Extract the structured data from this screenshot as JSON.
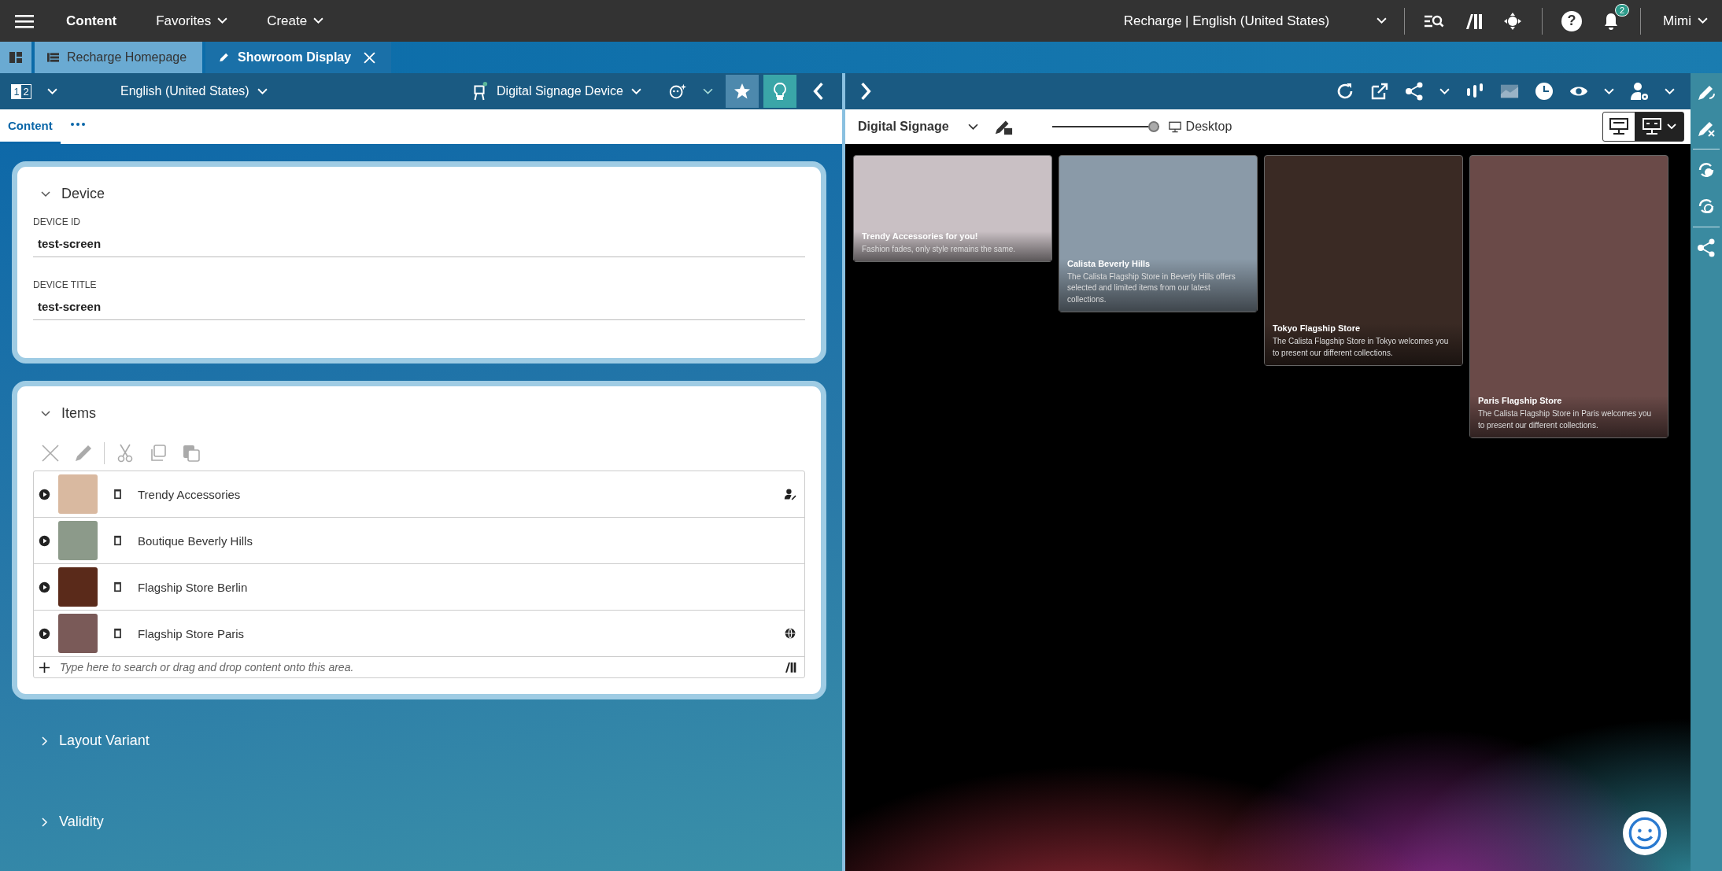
{
  "top_bar": {
    "nav": [
      {
        "label": "Content",
        "selected": true
      },
      {
        "label": "Favorites",
        "selected": false
      },
      {
        "label": "Create",
        "selected": false
      }
    ],
    "context": "Recharge | English (United States)",
    "help_glyph": "?",
    "notification_count": "2",
    "user": "Mimi"
  },
  "tabs": [
    {
      "label": "Recharge Homepage",
      "kind": "page",
      "selected": false
    },
    {
      "label": "Showroom Display",
      "kind": "edit",
      "selected": true
    }
  ],
  "editor_toolbar": {
    "compare_marks": [
      "1",
      "2"
    ],
    "locale": "English (United States)",
    "content_type": "Digital Signage Device"
  },
  "form_tabs": [
    {
      "label": "Content",
      "selected": true
    }
  ],
  "sections": [
    {
      "title": "Device",
      "kind": "fields",
      "expanded": true,
      "fields": [
        {
          "label": "DEVICE ID",
          "value": "test-screen"
        },
        {
          "label": "DEVICE TITLE",
          "value": "test-screen"
        }
      ]
    },
    {
      "title": "Items",
      "kind": "list",
      "expanded": true,
      "items": [
        {
          "title": "Trendy Accessories",
          "kind": "edited"
        },
        {
          "title": "Boutique Beverly Hills",
          "kind": "plain"
        },
        {
          "title": "Flagship Store Berlin",
          "kind": "plain"
        },
        {
          "title": "Flagship Store Paris",
          "kind": "published"
        }
      ],
      "placeholder": "Type here to search or drag and drop content onto this area."
    },
    {
      "title": "Layout Variant",
      "expanded": false
    },
    {
      "title": "Validity",
      "expanded": false
    }
  ],
  "preview": {
    "device": "Digital Signage",
    "viewport": "Desktop",
    "level": 1,
    "cards": [
      {
        "title": "Trendy Accessories for you!",
        "text": "Fashion fades, only style remains the same."
      },
      {
        "title": "Calista Beverly Hills",
        "text": "The Calista Flagship Store in Beverly Hills offers selected and limited items from our latest collections."
      },
      {
        "title": "Tokyo Flagship Store",
        "text": "The Calista Flagship Store in Tokyo welcomes you to present our different collections."
      },
      {
        "title": "Paris Flagship Store",
        "text": "The Calista Flagship Store in Paris welcomes you to present our different collections."
      }
    ]
  }
}
